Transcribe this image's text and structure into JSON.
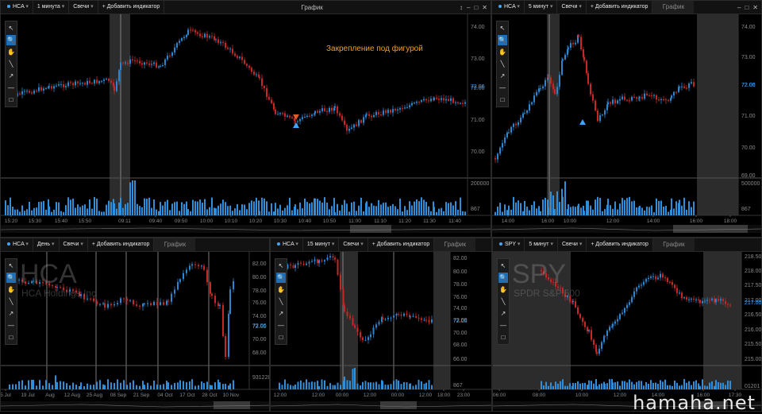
{
  "colors": {
    "up": "#2b86cf",
    "down": "#c62828",
    "accent": "#3ea6ff",
    "annotation": "#f0a020"
  },
  "panels": [
    {
      "id": "p1",
      "symbol": "HCA",
      "interval": "1 минута",
      "style": "Свечи",
      "add_indicator": "+ Добавить индикатор",
      "title": "График",
      "title_style": "center",
      "controls": [
        "↕",
        "–",
        "□",
        "✕"
      ],
      "annotation": "Закрепление под фигурой",
      "price_ticks": [
        "74.00",
        "73.00",
        "72.00",
        "71.00",
        "70.00"
      ],
      "price_current": "72.06",
      "volume_ticks": [
        "200000",
        "867"
      ],
      "time_ticks": [
        "15:20",
        "15:30",
        "15:40",
        "15:50",
        "09:11",
        "09:40",
        "09:50",
        "10:00",
        "10:10",
        "10:20",
        "10:30",
        "10:40",
        "10:50",
        "11:00",
        "11:10",
        "11:20",
        "11:30",
        "11:40"
      ],
      "tools": [
        "↖",
        "🔍",
        "✋",
        "╲",
        "↗",
        "—",
        "□"
      ]
    },
    {
      "id": "p2",
      "symbol": "HCA",
      "interval": "5 минут",
      "style": "Свечи",
      "add_indicator": "+ Добавить индикатор",
      "title": "График",
      "title_style": "dim",
      "controls": [
        "–",
        "□",
        "✕"
      ],
      "price_ticks": [
        "74.00",
        "73.00",
        "72.00",
        "71.00",
        "70.00",
        "69.00"
      ],
      "price_current": "72.06",
      "volume_ticks": [
        "500000",
        "867"
      ],
      "time_ticks": [
        "14:00",
        "16:00",
        "10:00",
        "12:00",
        "14:00",
        "16:00",
        "18:00"
      ],
      "tools": [
        "↖",
        "🔍",
        "✋",
        "╲",
        "↗",
        "—",
        "□"
      ]
    },
    {
      "id": "p3",
      "symbol": "HCA",
      "interval": "День",
      "style": "Свечи",
      "add_indicator": "+ Добавить индикатор",
      "title": "График",
      "title_style": "dim",
      "controls": [],
      "big_symbol": "HCA",
      "big_name": "HCA Holdings Inc",
      "price_ticks": [
        "82.00",
        "80.00",
        "78.00",
        "76.00",
        "74.00",
        "72.00",
        "70.00",
        "68.00"
      ],
      "price_current": "72.06",
      "volume_ticks": [
        "9312209"
      ],
      "time_ticks": [
        "5 Jul",
        "19 Jul",
        "Aug",
        "12 Aug",
        "25 Aug",
        "08 Sep",
        "21 Sep",
        "04 Oct",
        "17 Oct",
        "28 Oct",
        "10 Nov"
      ],
      "tools": [
        "↖",
        "🔍",
        "✋",
        "╲",
        "↗",
        "—",
        "□"
      ]
    },
    {
      "id": "p4",
      "symbol": "HCA",
      "interval": "15 минут",
      "style": "Свечи",
      "add_indicator": "+ Добавить индикатор",
      "title": "График",
      "title_style": "dim",
      "controls": [],
      "price_ticks": [
        "82.00",
        "80.00",
        "78.00",
        "76.00",
        "74.00",
        "72.00",
        "70.00",
        "68.00",
        "66.00"
      ],
      "price_current": "72.06",
      "volume_ticks": [
        "867"
      ],
      "time_ticks": [
        "12:00",
        "12:00",
        "00:00",
        "12:00",
        "00:00",
        "12:00",
        "18:00",
        "23:00"
      ],
      "tools": [
        "↖",
        "🔍",
        "✋",
        "╲",
        "↗",
        "—",
        "□"
      ]
    },
    {
      "id": "p5",
      "symbol": "SPY",
      "interval": "5 минут",
      "style": "Свечи",
      "add_indicator": "+ Добавить индикатор",
      "title": "График",
      "title_style": "dim",
      "controls": [],
      "big_symbol": "SPY",
      "big_name": "SPDR S&P 500",
      "price_ticks": [
        "218.50",
        "218.00",
        "217.50",
        "217.00",
        "216.50",
        "216.00",
        "215.50",
        "215.00"
      ],
      "price_current": "217.00",
      "volume_ticks": [
        "01201"
      ],
      "time_ticks": [
        "06:00",
        "08:00",
        "10:00",
        "12:00",
        "14:00",
        "16:00",
        "17:30"
      ],
      "tools": [
        "↖",
        "🔍",
        "✋",
        "╲",
        "↗",
        "—",
        "□"
      ]
    }
  ],
  "watermark": "hamaha.net"
}
